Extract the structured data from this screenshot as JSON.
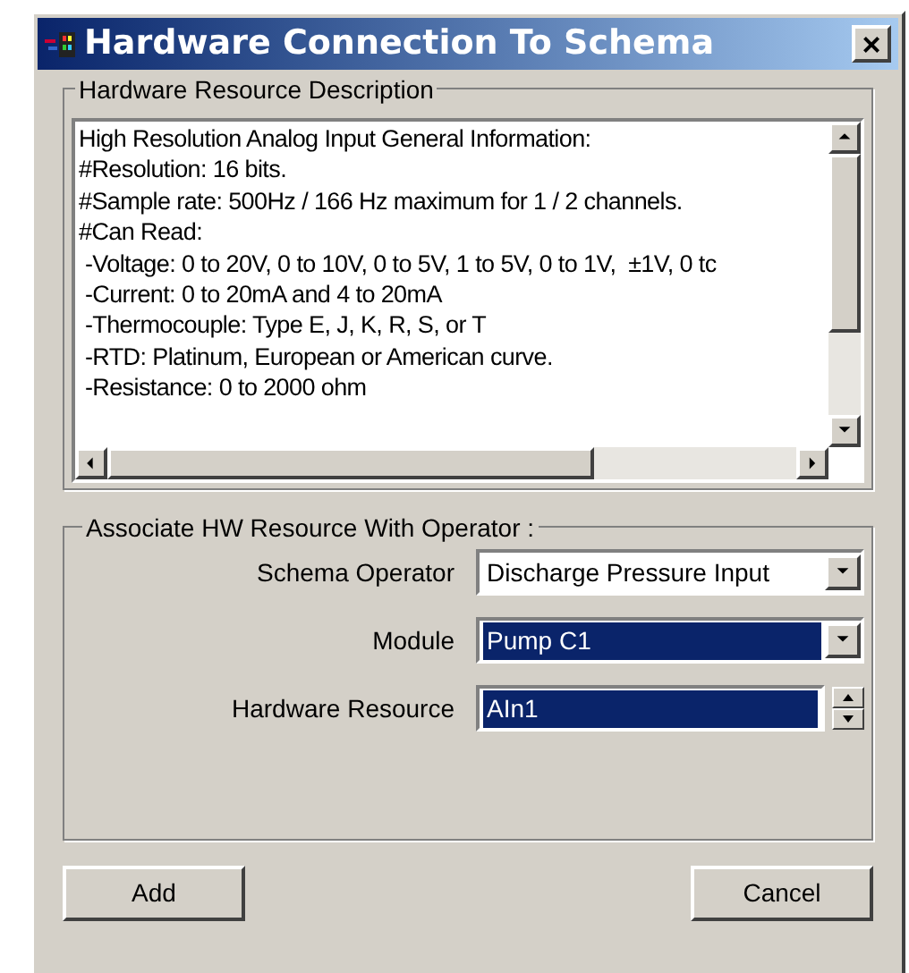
{
  "window": {
    "title": "Hardware Connection To Schema",
    "close": "×"
  },
  "description": {
    "legend": "Hardware Resource Description",
    "lines": [
      "High Resolution Analog Input General Information:",
      "#Resolution: 16 bits.",
      "#Sample rate: 500Hz / 166 Hz maximum for 1 / 2 channels.",
      "#Can Read:",
      " -Voltage: 0 to 20V, 0 to 10V, 0 to 5V, 1 to 5V, 0 to 1V,  ±1V, 0 tc",
      " -Current: 0 to 20mA and 4 to 20mA",
      " -Thermocouple: Type E, J, K, R, S, or T",
      " -RTD: Platinum, European or American curve.",
      " -Resistance: 0 to 2000 ohm"
    ]
  },
  "association": {
    "legend": "Associate HW Resource With Operator :",
    "fields": [
      {
        "label": "Schema Operator",
        "value": "Discharge Pressure Input",
        "kind": "dropdown",
        "selected": false
      },
      {
        "label": "Module",
        "value": "Pump C1",
        "kind": "dropdown",
        "selected": true
      },
      {
        "label": "Hardware Resource",
        "value": "AIn1",
        "kind": "spinner",
        "selected": true
      }
    ]
  },
  "buttons": [
    "Add",
    "Cancel"
  ]
}
